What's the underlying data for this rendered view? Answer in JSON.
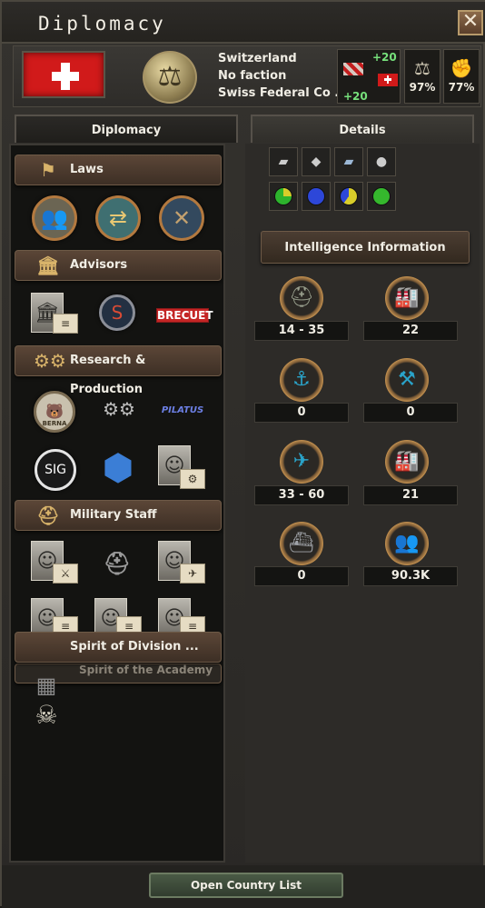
{
  "window": {
    "title": "Diplomacy"
  },
  "country": {
    "name": "Switzerland",
    "faction": "No faction",
    "government": "Swiss Federal Co ...",
    "relation_plus_top": "+20",
    "relation_plus_bottom": "+20",
    "stat_one_icon": "scales-icon",
    "stat_one_value": "97%",
    "stat_two_icon": "arm-icon",
    "stat_two_value": "77%"
  },
  "tabs": {
    "diplomacy": "Diplomacy",
    "details": "Details"
  },
  "sections": {
    "laws": "Laws",
    "advisors": "Advisors",
    "research": "Research & Production",
    "military": "Military Staff",
    "spirit": "Spirit of Division ...",
    "spirit_academy": "Spirit of the Academy"
  },
  "logos": {
    "brecuet": "BRECUET",
    "pilatus": "PILATUS",
    "sig": "SIG",
    "berna": "BERNA"
  },
  "intel": {
    "header": "Intelligence Information",
    "items": [
      {
        "icon": "helmet-icon",
        "value": "14 - 35"
      },
      {
        "icon": "factory-icon",
        "value": "22"
      },
      {
        "icon": "anchor-icon",
        "value": "0"
      },
      {
        "icon": "dockyard-icon",
        "value": "0"
      },
      {
        "icon": "plane-icon",
        "value": "33 - 60"
      },
      {
        "icon": "industry-icon",
        "value": "21"
      },
      {
        "icon": "ship-icon",
        "value": "0"
      },
      {
        "icon": "population-icon",
        "value": "90.3K"
      }
    ]
  },
  "resources": {
    "colors": [
      "#2db32d",
      "#2d47d9",
      "#d8cd2a",
      "#35b82d"
    ]
  },
  "bottom": {
    "open_country_list": "Open Country List"
  }
}
